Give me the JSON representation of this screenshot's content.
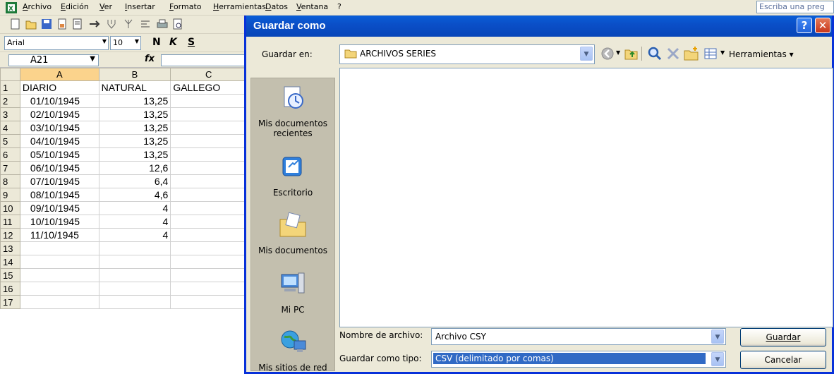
{
  "excel": {
    "menu": [
      "Archivo",
      "Edición",
      "Ver",
      "Insertar",
      "Formato",
      "Herramientas",
      "Datos",
      "Ventana",
      "?"
    ],
    "help_box_placeholder": "Escriba una preg",
    "font_name": "Arial",
    "font_size": "10",
    "format_buttons": {
      "bold": "N",
      "italic": "K",
      "underline": "S"
    },
    "name_box": "A21",
    "fx_label": "fx",
    "columns": [
      "A",
      "B",
      "C"
    ],
    "rows": [
      {
        "n": "1",
        "a": "DIARIO",
        "b": "NATURAL",
        "c": "GALLEGO"
      },
      {
        "n": "2",
        "a": "01/10/1945",
        "b": "13,25",
        "c": ""
      },
      {
        "n": "3",
        "a": "02/10/1945",
        "b": "13,25",
        "c": ""
      },
      {
        "n": "4",
        "a": "03/10/1945",
        "b": "13,25",
        "c": ""
      },
      {
        "n": "5",
        "a": "04/10/1945",
        "b": "13,25",
        "c": ""
      },
      {
        "n": "6",
        "a": "05/10/1945",
        "b": "13,25",
        "c": ""
      },
      {
        "n": "7",
        "a": "06/10/1945",
        "b": "12,6",
        "c": ""
      },
      {
        "n": "8",
        "a": "07/10/1945",
        "b": "6,4",
        "c": ""
      },
      {
        "n": "9",
        "a": "08/10/1945",
        "b": "4,6",
        "c": ""
      },
      {
        "n": "10",
        "a": "09/10/1945",
        "b": "4",
        "c": ""
      },
      {
        "n": "11",
        "a": "10/10/1945",
        "b": "4",
        "c": ""
      },
      {
        "n": "12",
        "a": "11/10/1945",
        "b": "4",
        "c": ""
      },
      {
        "n": "13",
        "a": "",
        "b": "",
        "c": ""
      },
      {
        "n": "14",
        "a": "",
        "b": "",
        "c": ""
      },
      {
        "n": "15",
        "a": "",
        "b": "",
        "c": ""
      },
      {
        "n": "16",
        "a": "",
        "b": "",
        "c": ""
      },
      {
        "n": "17",
        "a": "",
        "b": "",
        "c": ""
      }
    ]
  },
  "dialog": {
    "title": "Guardar como",
    "help": "?",
    "close": "✕",
    "look_in_label": "Guardar en:",
    "look_in_value": "ARCHIVOS SERIES",
    "tools_label": "Herramientas",
    "places": [
      {
        "label": "Mis documentos recientes",
        "icon": "recent-documents-icon"
      },
      {
        "label": "Escritorio",
        "icon": "desktop-icon"
      },
      {
        "label": "Mis documentos",
        "icon": "my-documents-icon"
      },
      {
        "label": "Mi PC",
        "icon": "my-computer-icon"
      },
      {
        "label": "Mis sitios de red",
        "icon": "network-places-icon"
      }
    ],
    "filename_label": "Nombre de archivo:",
    "filename_value": "Archivo CSY",
    "filetype_label": "Guardar como tipo:",
    "filetype_value": "CSV (delimitado por comas)",
    "save_button": "Guardar",
    "cancel_button": "Cancelar"
  }
}
